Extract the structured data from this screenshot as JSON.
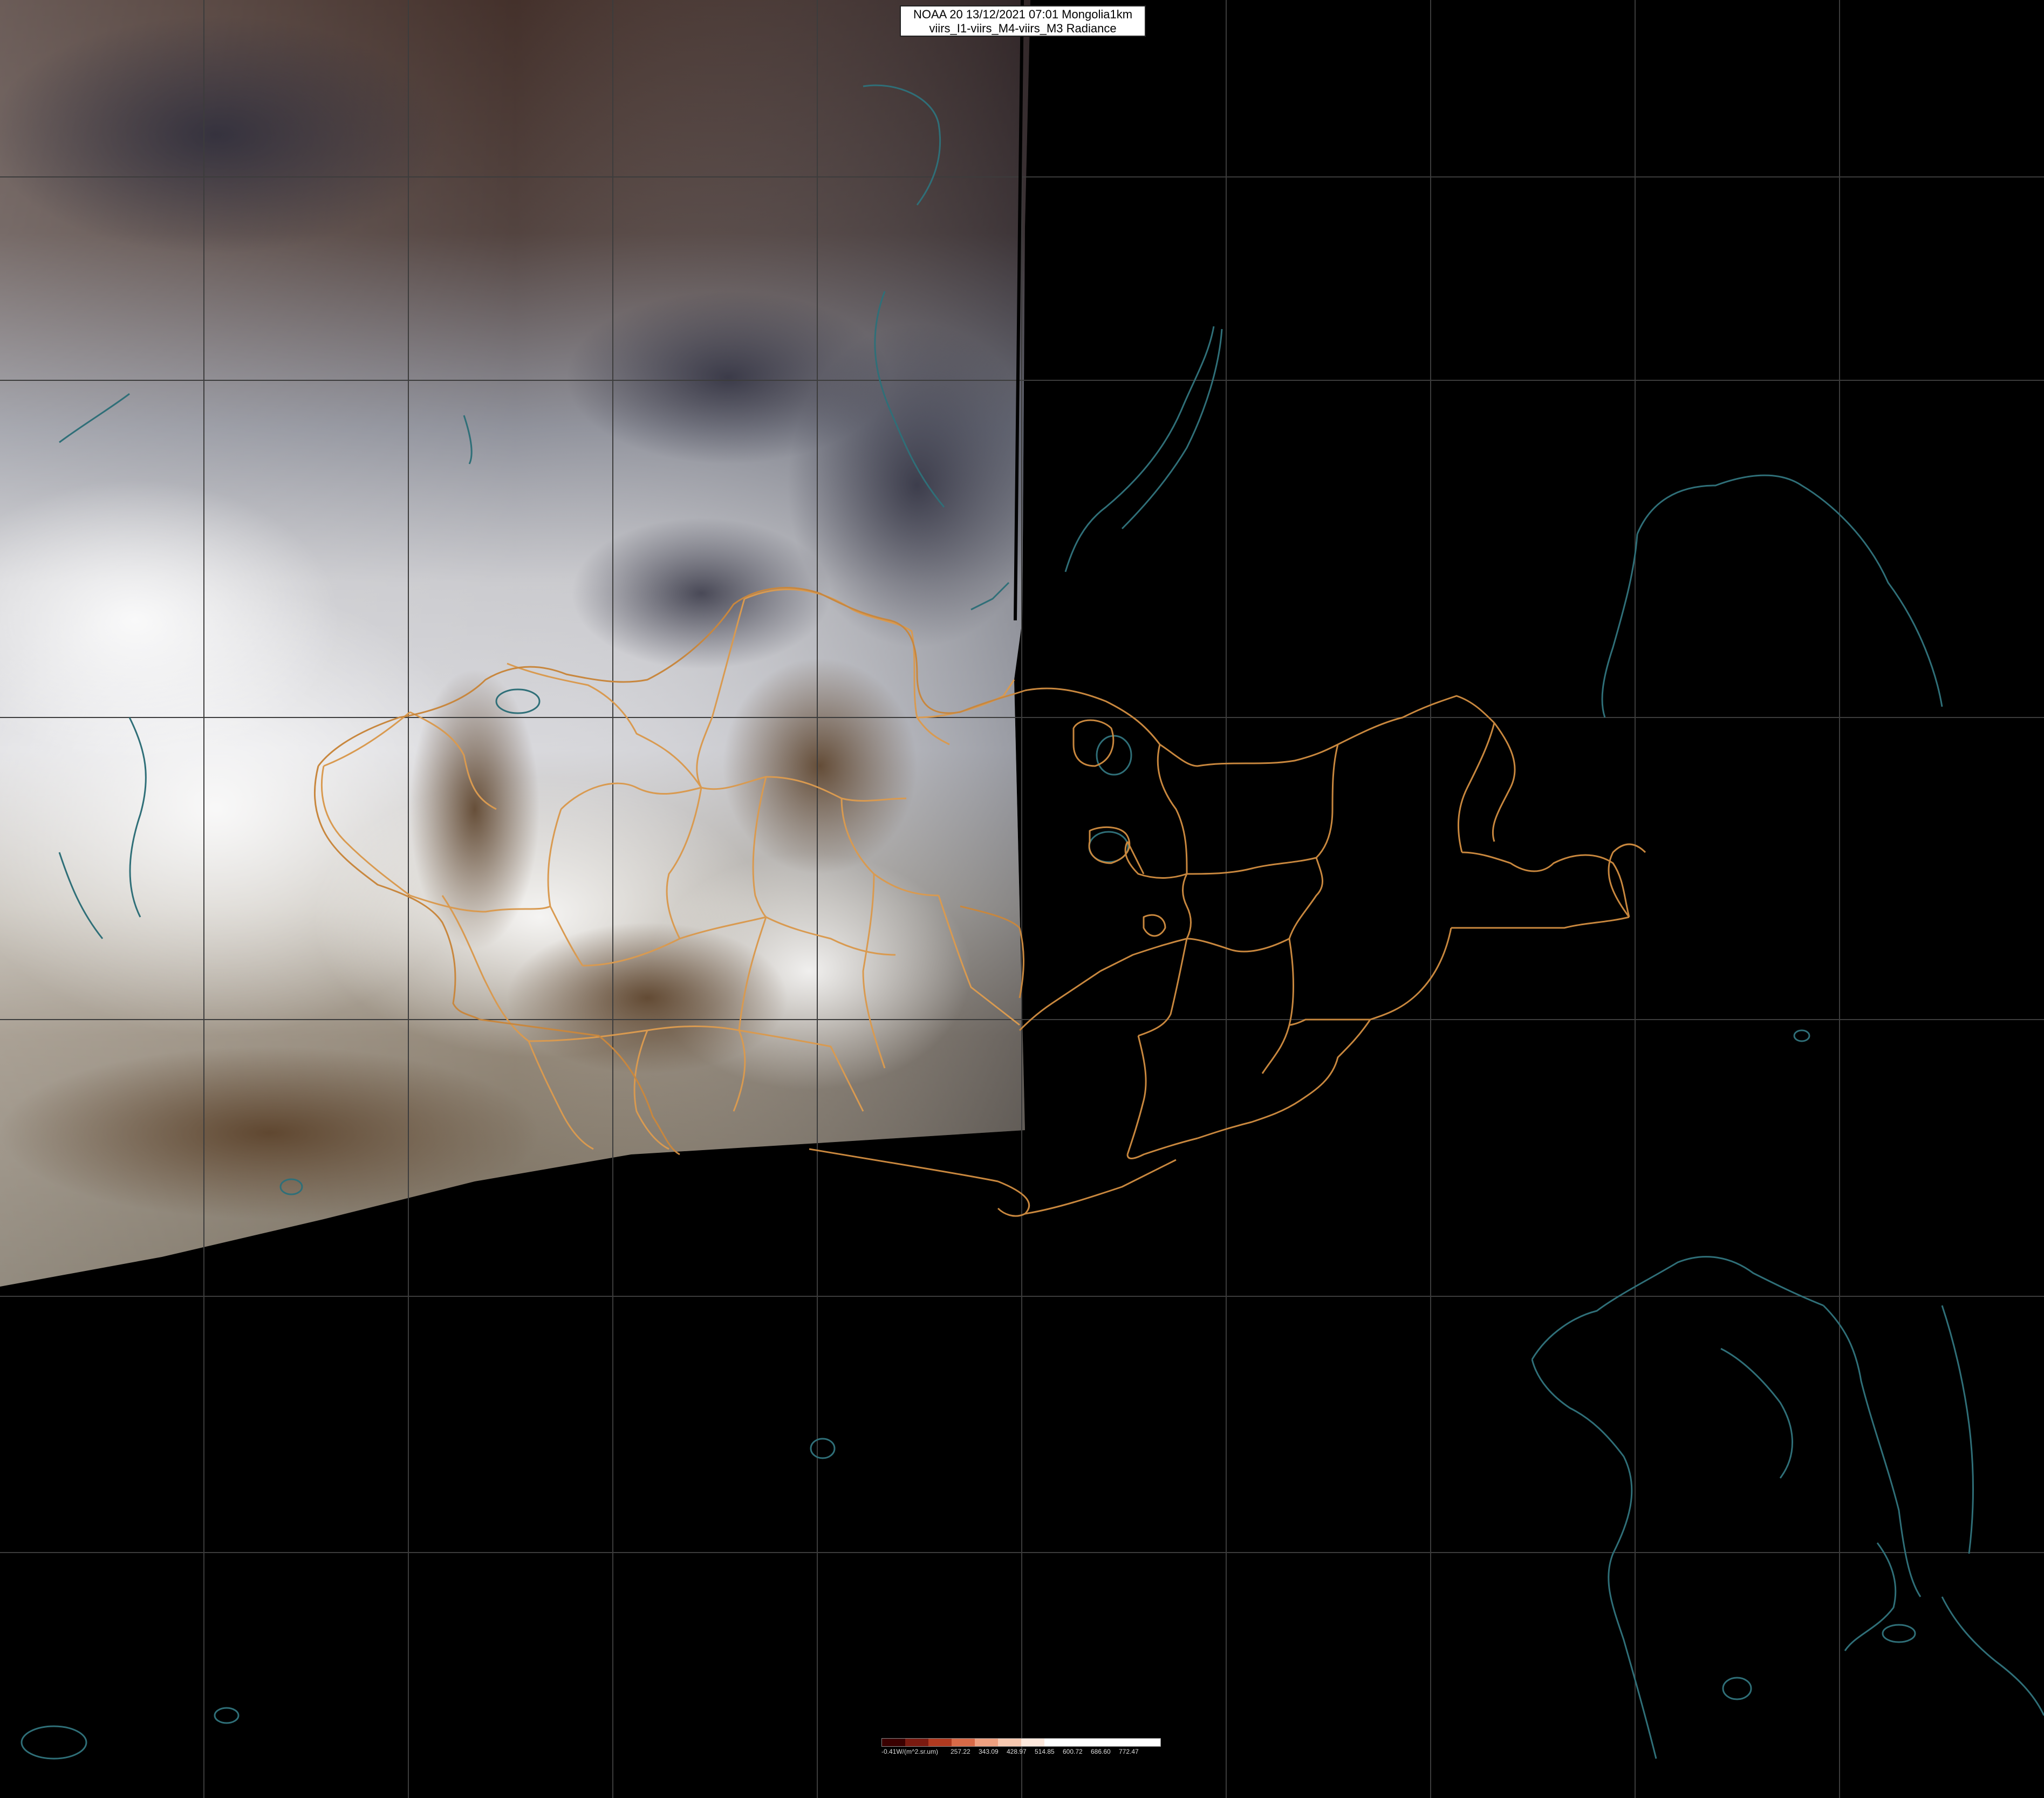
{
  "title": {
    "line1": "NOAA 20 13/12/2021 07:01 Mongolia1km",
    "line2": "viirs_I1-viirs_M4-viirs_M3 Radiance"
  },
  "legend": {
    "unit": "-0.41W/(m^2.sr.um)",
    "ticks": [
      "257.22",
      "343.09",
      "428.97",
      "514.85",
      "600.72",
      "686.60",
      "772.47"
    ],
    "colors": [
      "#3a0000",
      "#7a1a10",
      "#b03a20",
      "#d86a48",
      "#eea080",
      "#f6c8b0",
      "#fde8dc",
      "#ffffff",
      "#ffffff",
      "#ffffff",
      "#ffffff",
      "#ffffff"
    ]
  },
  "colors": {
    "grid": "#3c3c3c",
    "border_country": "#c8873e",
    "border_province": "#d99a50",
    "coastline": "#2f6f78",
    "background": "#000000"
  }
}
